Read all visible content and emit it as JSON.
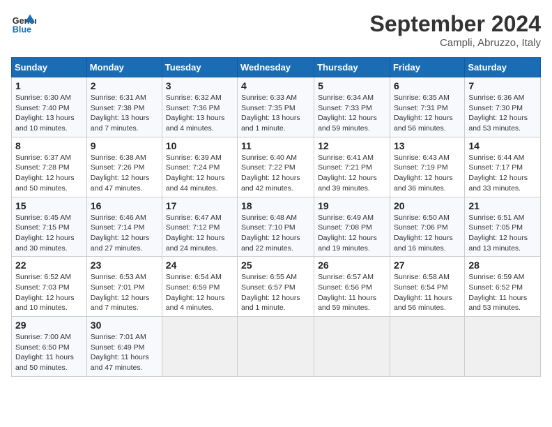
{
  "logo": {
    "line1": "General",
    "line2": "Blue"
  },
  "title": "September 2024",
  "subtitle": "Campli, Abruzzo, Italy",
  "days_header": [
    "Sunday",
    "Monday",
    "Tuesday",
    "Wednesday",
    "Thursday",
    "Friday",
    "Saturday"
  ],
  "weeks": [
    [
      {
        "num": "1",
        "detail": "Sunrise: 6:30 AM\nSunset: 7:40 PM\nDaylight: 13 hours\nand 10 minutes."
      },
      {
        "num": "2",
        "detail": "Sunrise: 6:31 AM\nSunset: 7:38 PM\nDaylight: 13 hours\nand 7 minutes."
      },
      {
        "num": "3",
        "detail": "Sunrise: 6:32 AM\nSunset: 7:36 PM\nDaylight: 13 hours\nand 4 minutes."
      },
      {
        "num": "4",
        "detail": "Sunrise: 6:33 AM\nSunset: 7:35 PM\nDaylight: 13 hours\nand 1 minute."
      },
      {
        "num": "5",
        "detail": "Sunrise: 6:34 AM\nSunset: 7:33 PM\nDaylight: 12 hours\nand 59 minutes."
      },
      {
        "num": "6",
        "detail": "Sunrise: 6:35 AM\nSunset: 7:31 PM\nDaylight: 12 hours\nand 56 minutes."
      },
      {
        "num": "7",
        "detail": "Sunrise: 6:36 AM\nSunset: 7:30 PM\nDaylight: 12 hours\nand 53 minutes."
      }
    ],
    [
      {
        "num": "8",
        "detail": "Sunrise: 6:37 AM\nSunset: 7:28 PM\nDaylight: 12 hours\nand 50 minutes."
      },
      {
        "num": "9",
        "detail": "Sunrise: 6:38 AM\nSunset: 7:26 PM\nDaylight: 12 hours\nand 47 minutes."
      },
      {
        "num": "10",
        "detail": "Sunrise: 6:39 AM\nSunset: 7:24 PM\nDaylight: 12 hours\nand 44 minutes."
      },
      {
        "num": "11",
        "detail": "Sunrise: 6:40 AM\nSunset: 7:22 PM\nDaylight: 12 hours\nand 42 minutes."
      },
      {
        "num": "12",
        "detail": "Sunrise: 6:41 AM\nSunset: 7:21 PM\nDaylight: 12 hours\nand 39 minutes."
      },
      {
        "num": "13",
        "detail": "Sunrise: 6:43 AM\nSunset: 7:19 PM\nDaylight: 12 hours\nand 36 minutes."
      },
      {
        "num": "14",
        "detail": "Sunrise: 6:44 AM\nSunset: 7:17 PM\nDaylight: 12 hours\nand 33 minutes."
      }
    ],
    [
      {
        "num": "15",
        "detail": "Sunrise: 6:45 AM\nSunset: 7:15 PM\nDaylight: 12 hours\nand 30 minutes."
      },
      {
        "num": "16",
        "detail": "Sunrise: 6:46 AM\nSunset: 7:14 PM\nDaylight: 12 hours\nand 27 minutes."
      },
      {
        "num": "17",
        "detail": "Sunrise: 6:47 AM\nSunset: 7:12 PM\nDaylight: 12 hours\nand 24 minutes."
      },
      {
        "num": "18",
        "detail": "Sunrise: 6:48 AM\nSunset: 7:10 PM\nDaylight: 12 hours\nand 22 minutes."
      },
      {
        "num": "19",
        "detail": "Sunrise: 6:49 AM\nSunset: 7:08 PM\nDaylight: 12 hours\nand 19 minutes."
      },
      {
        "num": "20",
        "detail": "Sunrise: 6:50 AM\nSunset: 7:06 PM\nDaylight: 12 hours\nand 16 minutes."
      },
      {
        "num": "21",
        "detail": "Sunrise: 6:51 AM\nSunset: 7:05 PM\nDaylight: 12 hours\nand 13 minutes."
      }
    ],
    [
      {
        "num": "22",
        "detail": "Sunrise: 6:52 AM\nSunset: 7:03 PM\nDaylight: 12 hours\nand 10 minutes."
      },
      {
        "num": "23",
        "detail": "Sunrise: 6:53 AM\nSunset: 7:01 PM\nDaylight: 12 hours\nand 7 minutes."
      },
      {
        "num": "24",
        "detail": "Sunrise: 6:54 AM\nSunset: 6:59 PM\nDaylight: 12 hours\nand 4 minutes."
      },
      {
        "num": "25",
        "detail": "Sunrise: 6:55 AM\nSunset: 6:57 PM\nDaylight: 12 hours\nand 1 minute."
      },
      {
        "num": "26",
        "detail": "Sunrise: 6:57 AM\nSunset: 6:56 PM\nDaylight: 11 hours\nand 59 minutes."
      },
      {
        "num": "27",
        "detail": "Sunrise: 6:58 AM\nSunset: 6:54 PM\nDaylight: 11 hours\nand 56 minutes."
      },
      {
        "num": "28",
        "detail": "Sunrise: 6:59 AM\nSunset: 6:52 PM\nDaylight: 11 hours\nand 53 minutes."
      }
    ],
    [
      {
        "num": "29",
        "detail": "Sunrise: 7:00 AM\nSunset: 6:50 PM\nDaylight: 11 hours\nand 50 minutes."
      },
      {
        "num": "30",
        "detail": "Sunrise: 7:01 AM\nSunset: 6:49 PM\nDaylight: 11 hours\nand 47 minutes."
      },
      {
        "num": "",
        "detail": ""
      },
      {
        "num": "",
        "detail": ""
      },
      {
        "num": "",
        "detail": ""
      },
      {
        "num": "",
        "detail": ""
      },
      {
        "num": "",
        "detail": ""
      }
    ]
  ]
}
